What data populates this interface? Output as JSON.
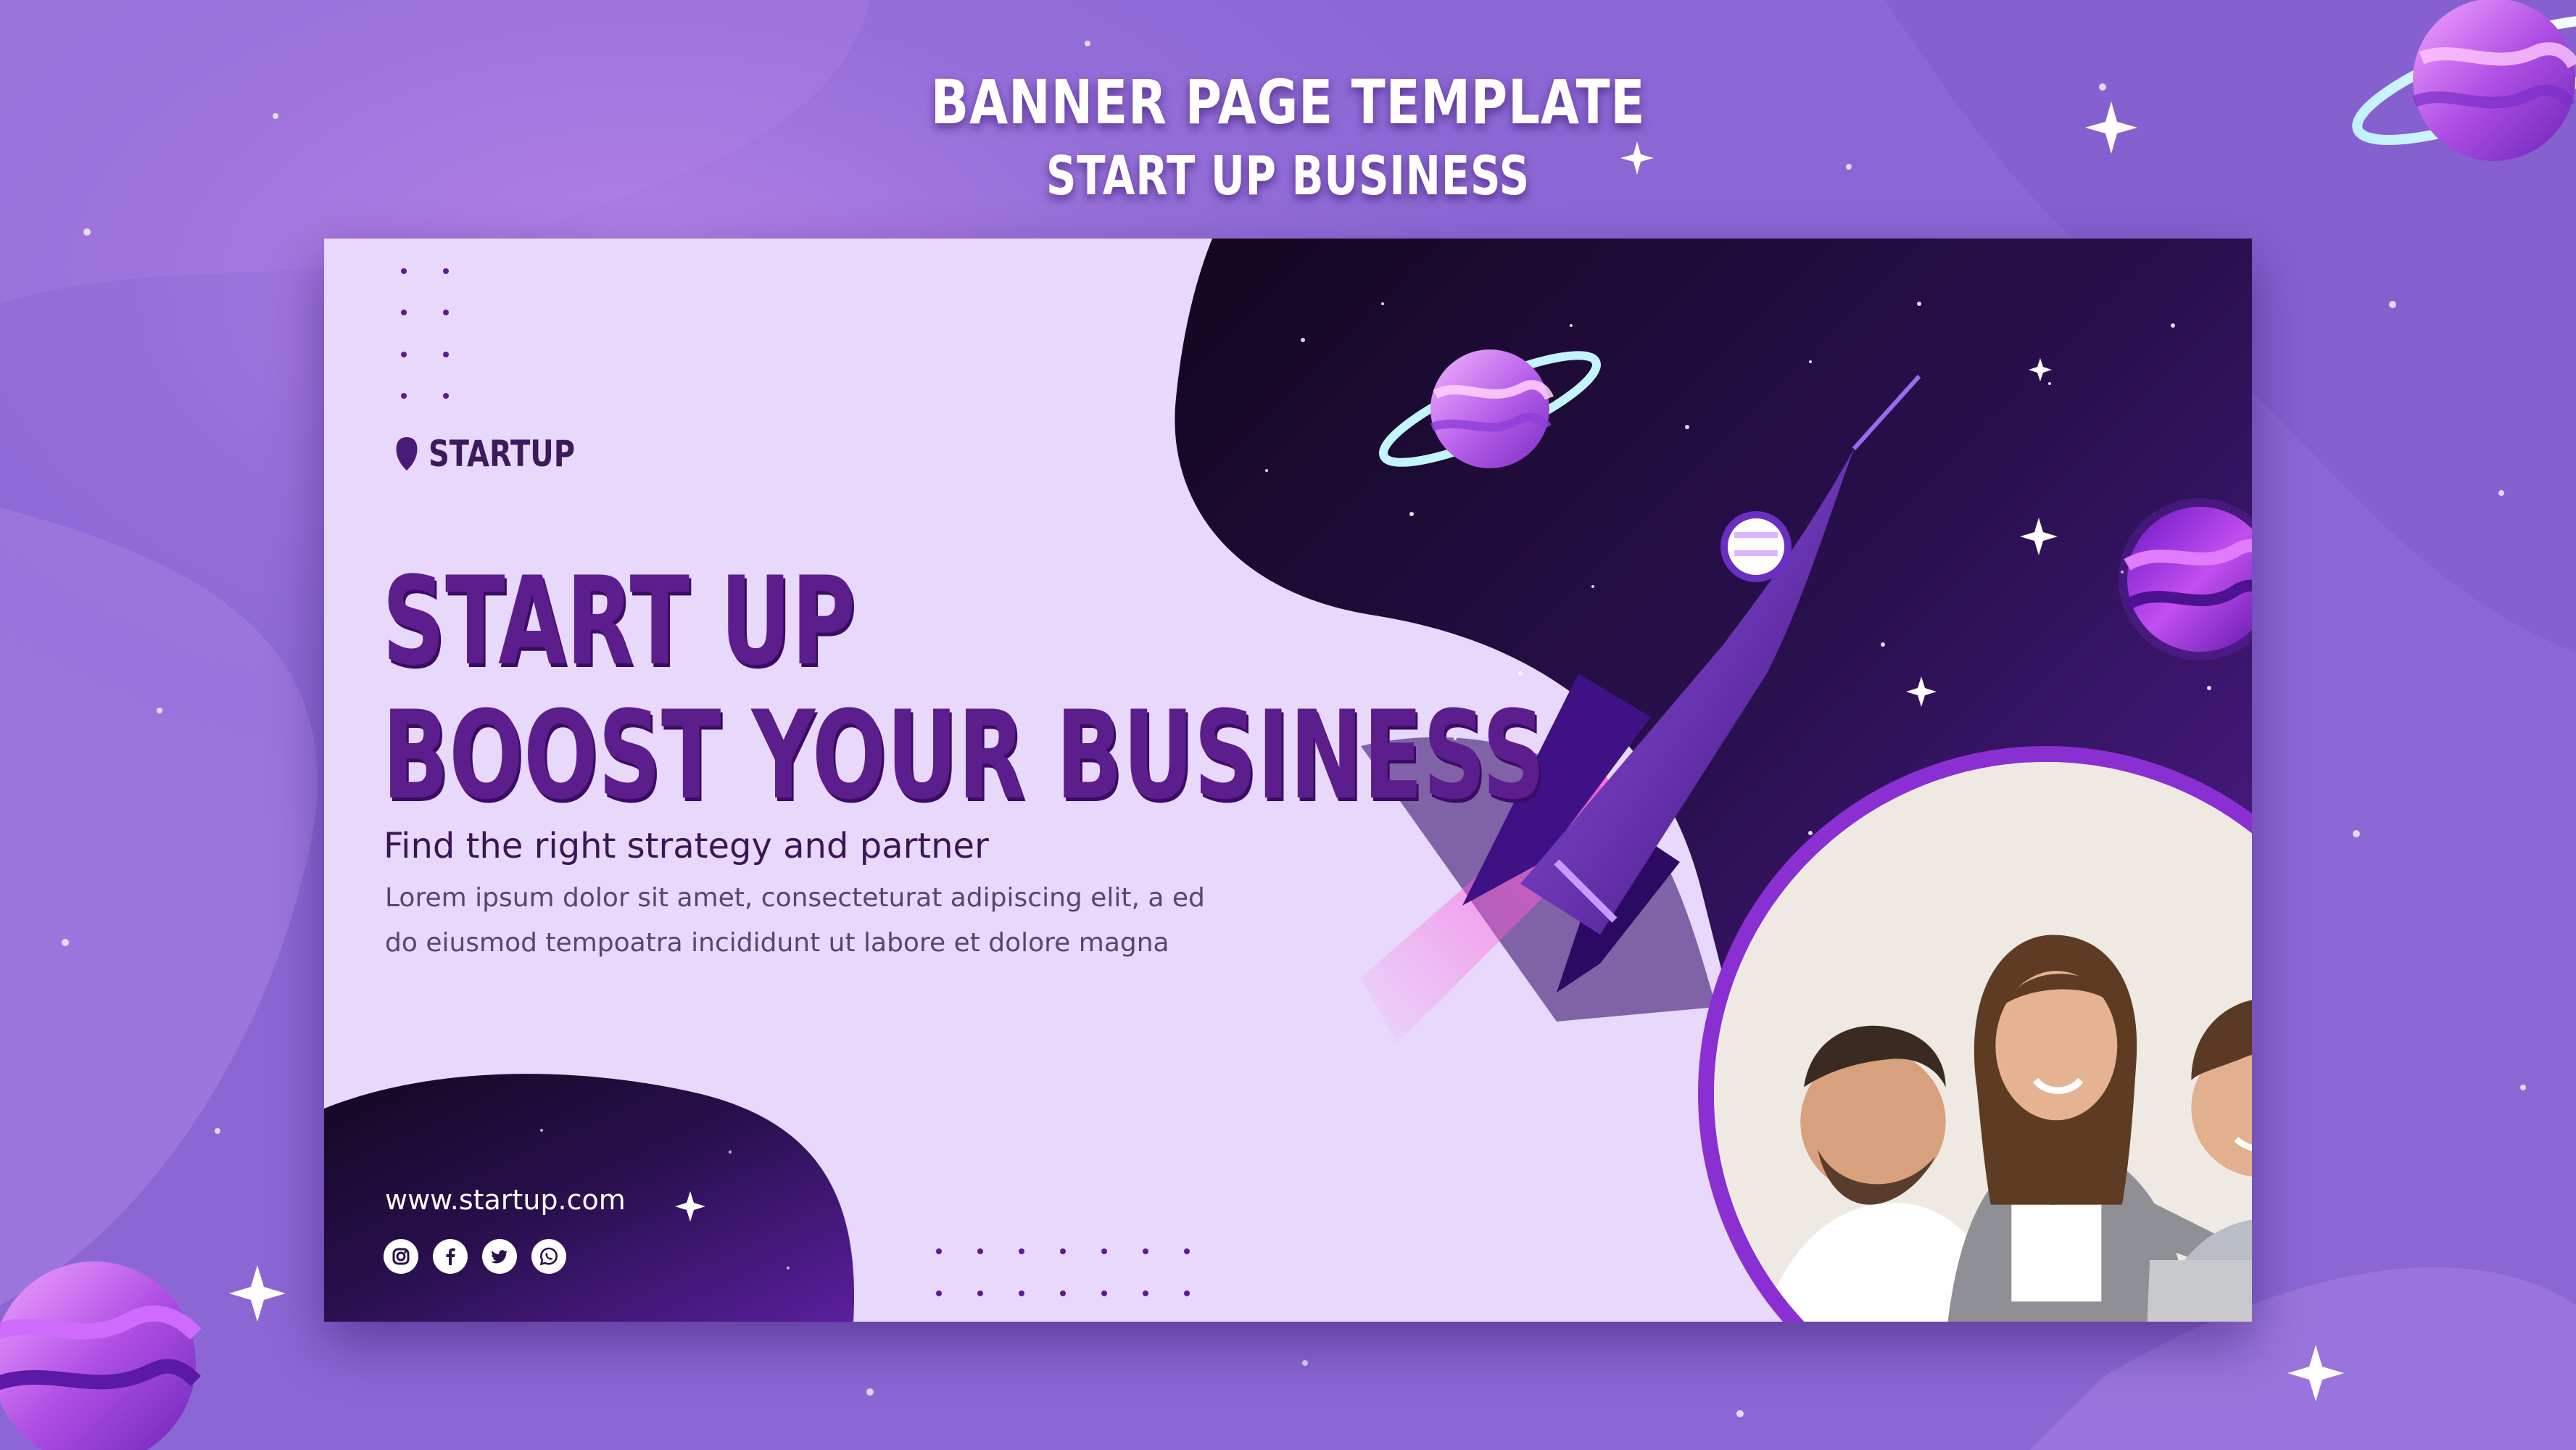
{
  "header": {
    "line1": "BANNER PAGE TEMPLATE",
    "line2": "START UP  BUSINESS"
  },
  "banner": {
    "logo_text": "STARTUP",
    "headline_1": "START UP",
    "headline_2": "BOOST YOUR BUSINESS",
    "subheading": "Find the right strategy and partner",
    "body_line_1": "Lorem ipsum dolor sit amet, consecteturat adipiscing elit, a ed",
    "body_line_2": "do eiusmod tempoatra incididunt ut labore et dolore magna",
    "website": "www.startup.com",
    "socials": [
      "instagram-icon",
      "facebook-icon",
      "twitter-icon",
      "whatsapp-icon"
    ]
  },
  "colors": {
    "background": "#8c67d4",
    "banner_light": "#e8d8fb",
    "headline": "#5b1e8c",
    "space_dark": "#1a0b2e",
    "accent_pink": "#e34cd0"
  }
}
